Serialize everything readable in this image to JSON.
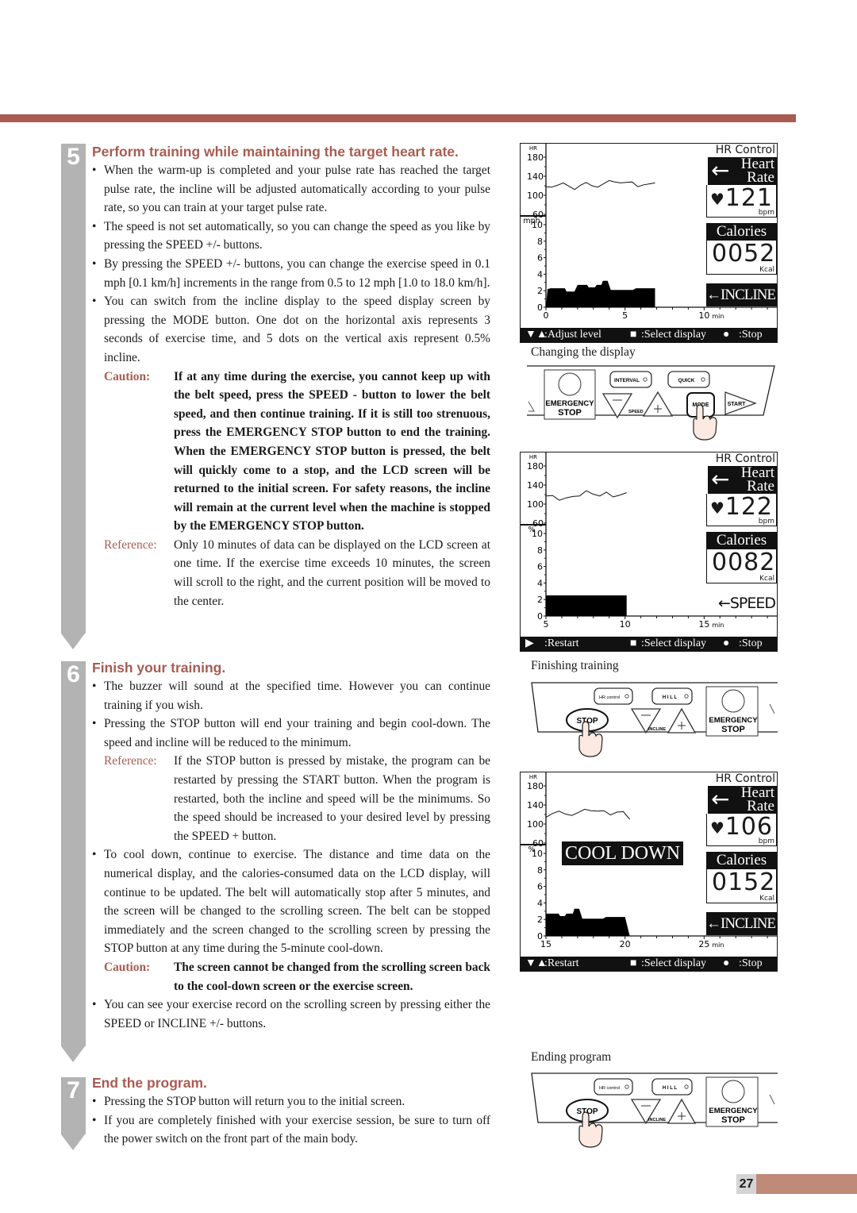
{
  "page_number": "27",
  "colors": {
    "accent": "#a85c52",
    "step_gray": "#b3b3b3",
    "page_tab": "#c08a78"
  },
  "steps": [
    {
      "number": "5",
      "title": "Perform training while maintaining the target heart rate.",
      "bullets": [
        "When the warm-up is completed and your pulse rate has reached the target pulse rate, the incline will be adjusted automatically according to your pulse rate, so you can train at your target pulse rate.",
        "The speed is not set automatically, so you can change the speed as you like by pressing the SPEED +/- buttons.",
        "By pressing the SPEED +/- buttons, you can change the exercise speed in 0.1 mph [0.1 km/h] increments in the range from 0.5 to 12 mph [1.0 to 18.0 km/h].",
        "You can switch from the incline display to the speed display screen by pressing the MODE button. One dot on the horizontal axis represents 3 seconds of exercise time, and 5 dots on the vertical axis represent 0.5% incline."
      ],
      "caution": {
        "label": "Caution:",
        "text": "If at any time during the exercise, you cannot keep up with the belt speed, press the SPEED - button to lower the belt speed, and then continue training. If it is still too strenuous, press the EMERGENCY STOP button to end the training. When the EMERGENCY STOP button is pressed, the belt will quickly come to a stop, and the LCD screen will be returned to the initial screen. For safety reasons, the incline will remain at the current level when the machine is stopped by the EMERGENCY STOP button."
      },
      "reference": {
        "label": "Reference:",
        "text": "Only 10 minutes of data can be displayed on the LCD screen at one time. If the exercise time exceeds 10 minutes, the screen will scroll to the right, and the current position will be moved to the center."
      }
    },
    {
      "number": "6",
      "title": "Finish your training.",
      "bullets": [
        "The buzzer will sound at the specified time. However you can continue training if you wish.",
        "Pressing the STOP button will end your training and begin cool-down. The speed and incline will be reduced to the minimum."
      ],
      "reference": {
        "label": "Reference:",
        "text": "If the STOP button is pressed by mistake, the program can be restarted by pressing the START button. When the program is restarted, both the incline and speed will be the minimums. So the speed should be increased to your desired level by pressing the SPEED + button."
      },
      "bullets2": [
        "To cool down, continue to exercise. The distance and time data on the numerical display, and the calories-consumed data on the LCD display, will continue to be updated. The belt will automatically stop after 5 minutes, and the screen will be changed to the scrolling screen. The belt can be stopped immediately and the screen changed to the scrolling screen by pressing the STOP button at any time during the 5-minute cool-down."
      ],
      "caution": {
        "label": "Caution:",
        "text": "The screen cannot be changed from the scrolling screen back to the cool-down screen or the exercise screen."
      },
      "bullets3": [
        "You can see your exercise record on the scrolling screen by pressing either the SPEED or INCLINE +/- buttons."
      ]
    },
    {
      "number": "7",
      "title": "End the program.",
      "bullets": [
        "Pressing the STOP button will return you to the initial screen.",
        "If you are completely finished with your exercise session, be sure to turn off the power switch on the front part of the main body."
      ]
    }
  ],
  "lcd_screens": [
    {
      "mode_title": "HR Control",
      "hr_label_1": "Heart",
      "hr_label_2": "Rate",
      "heart_rate": "121",
      "hr_unit": "bpm",
      "calories_label": "Calories",
      "calories": "0052",
      "cal_unit": "Kcal",
      "mode_tag": "INCLINE",
      "arrow": "←",
      "hr_axis_label": "HR",
      "hr_ticks": [
        "180",
        "140",
        "100",
        "60"
      ],
      "lower_axis_label": "mph",
      "lower_ticks": [
        "10",
        "8",
        "6",
        "4",
        "2",
        "0"
      ],
      "x_ticks": [
        "0",
        "5",
        "10"
      ],
      "x_unit": "min",
      "footer": [
        ":Adjust level",
        ":Select display",
        ":Stop"
      ],
      "footer_icon": "▼▲",
      "x_start": 0,
      "hr_series": [
        118,
        117,
        121,
        126,
        119,
        112,
        121,
        127,
        120,
        117,
        124,
        131,
        128,
        126,
        127,
        128,
        118,
        122,
        124,
        126
      ],
      "lower_series": [
        [
          0,
          0
        ],
        [
          0.1,
          2.2
        ],
        [
          0.3,
          2.3
        ],
        [
          1.2,
          2.3
        ],
        [
          1.3,
          1.9
        ],
        [
          1.8,
          1.9
        ],
        [
          2.0,
          2.7
        ],
        [
          2.6,
          2.7
        ],
        [
          2.7,
          2.4
        ],
        [
          3.1,
          2.4
        ],
        [
          3.2,
          2.7
        ],
        [
          3.5,
          2.7
        ],
        [
          3.6,
          3.2
        ],
        [
          3.9,
          3.2
        ],
        [
          4.1,
          2.1
        ],
        [
          5.5,
          2.1
        ],
        [
          5.7,
          2.3
        ],
        [
          6.9,
          2.3
        ],
        [
          6.9,
          0
        ]
      ]
    },
    {
      "mode_title": "HR Control",
      "hr_label_1": "Heart",
      "hr_label_2": "Rate",
      "heart_rate": "122",
      "hr_unit": "bpm",
      "calories_label": "Calories",
      "calories": "0082",
      "cal_unit": "Kcal",
      "mode_tag": "SPEED",
      "arrow": "←",
      "hr_axis_label": "HR",
      "hr_ticks": [
        "180",
        "140",
        "100",
        "60"
      ],
      "lower_axis_label": "%",
      "lower_ticks": [
        "10",
        "8",
        "6",
        "4",
        "2",
        "0"
      ],
      "x_ticks": [
        "5",
        "10",
        "15"
      ],
      "x_unit": "min",
      "footer": [
        ":Restart",
        ":Select display",
        ":Stop"
      ],
      "footer_icon": "▶",
      "x_start": 5,
      "hr_series": [
        117,
        118,
        108,
        113,
        116,
        117,
        128,
        121,
        117,
        125,
        115,
        119,
        124
      ],
      "lower_series": [
        [
          5,
          0
        ],
        [
          5,
          2.5
        ],
        [
          10.1,
          2.5
        ],
        [
          10.1,
          0
        ]
      ]
    },
    {
      "mode_title": "HR Control",
      "hr_label_1": "Heart",
      "hr_label_2": "Rate",
      "heart_rate": "106",
      "hr_unit": "bpm",
      "calories_label": "Calories",
      "calories": "0152",
      "cal_unit": "Kcal",
      "mode_tag": "INCLINE",
      "arrow": "←",
      "hr_axis_label": "HR",
      "hr_ticks": [
        "180",
        "140",
        "100",
        "60"
      ],
      "lower_axis_label": "%",
      "lower_ticks": [
        "10",
        "8",
        "6",
        "4",
        "2",
        "0"
      ],
      "x_ticks": [
        "15",
        "20",
        "25"
      ],
      "x_unit": "min",
      "footer": [
        ":Restart",
        ":Select display",
        ":Stop"
      ],
      "footer_icon": "▼▲",
      "overlay": "COOL DOWN",
      "x_start": 15,
      "hr_series": [
        114,
        122,
        127,
        121,
        118,
        124,
        131,
        128,
        127,
        128,
        119,
        125,
        126,
        110
      ],
      "lower_series": [
        [
          15,
          0
        ],
        [
          15,
          2.7
        ],
        [
          15.8,
          2.7
        ],
        [
          15.9,
          2.4
        ],
        [
          16.2,
          2.4
        ],
        [
          16.3,
          2.7
        ],
        [
          16.7,
          2.7
        ],
        [
          16.8,
          3.3
        ],
        [
          17.1,
          3.3
        ],
        [
          17.3,
          2.1
        ],
        [
          18.6,
          2.1
        ],
        [
          18.8,
          2.3
        ],
        [
          20.0,
          2.3
        ],
        [
          20.3,
          0
        ]
      ]
    }
  ],
  "captions": [
    "Changing the display",
    "Finishing training",
    "Ending program"
  ],
  "console_mode": {
    "interval": "INTERVAL",
    "quick": "QUICK",
    "emergency_1": "EMERGENCY",
    "emergency_2": "STOP",
    "speed": "SPEED",
    "mode": "MODE",
    "start": "START"
  },
  "console_stop": {
    "hr_control": "HR control",
    "hill": "H I L L",
    "stop": "STOP",
    "incline": "INCLINE",
    "emergency_1": "EMERGENCY",
    "emergency_2": "STOP"
  }
}
